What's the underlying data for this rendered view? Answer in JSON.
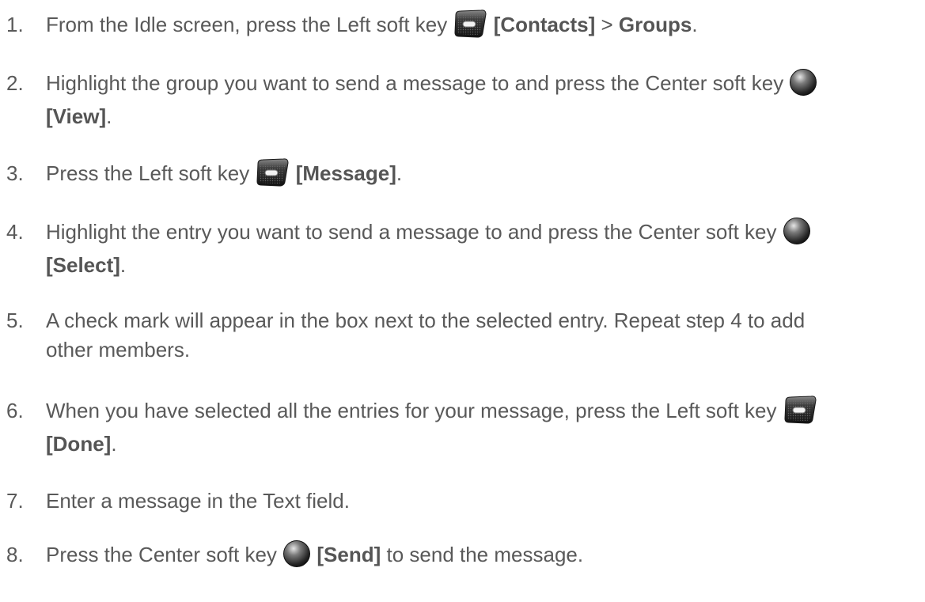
{
  "steps": [
    {
      "num": "1.",
      "t1": "From the Idle screen, press the Left soft key ",
      "k1": "[Contacts]",
      "t2": " > ",
      "k2": "Groups",
      "t3": "."
    },
    {
      "num": "2.",
      "t1": "Highlight the group you want to send a message to and press the Center soft key ",
      "k1": "[View]",
      "t2": "."
    },
    {
      "num": "3.",
      "t1": "Press the Left soft key ",
      "k1": "[Message]",
      "t2": "."
    },
    {
      "num": "4.",
      "t1": "Highlight the entry you want to send a message to and press the Center soft key ",
      "k1": "[Select]",
      "t2": "."
    },
    {
      "num": "5.",
      "l1": "A check mark will appear in the box next to the selected entry. Repeat step 4 to add",
      "l2": "other members."
    },
    {
      "num": "6.",
      "t1": "When you have selected all the entries for your message, press the Left soft key ",
      "k1": "[Done]",
      "t2": "."
    },
    {
      "num": "7.",
      "t1": "Enter a message in the Text field."
    },
    {
      "num": "8.",
      "t1": "Press the Center soft key ",
      "k1": "[Send]",
      "t2": " to send the message."
    }
  ],
  "icons": {
    "left_soft_key": "left-soft-key-icon",
    "center_soft_key": "center-soft-key-icon"
  }
}
